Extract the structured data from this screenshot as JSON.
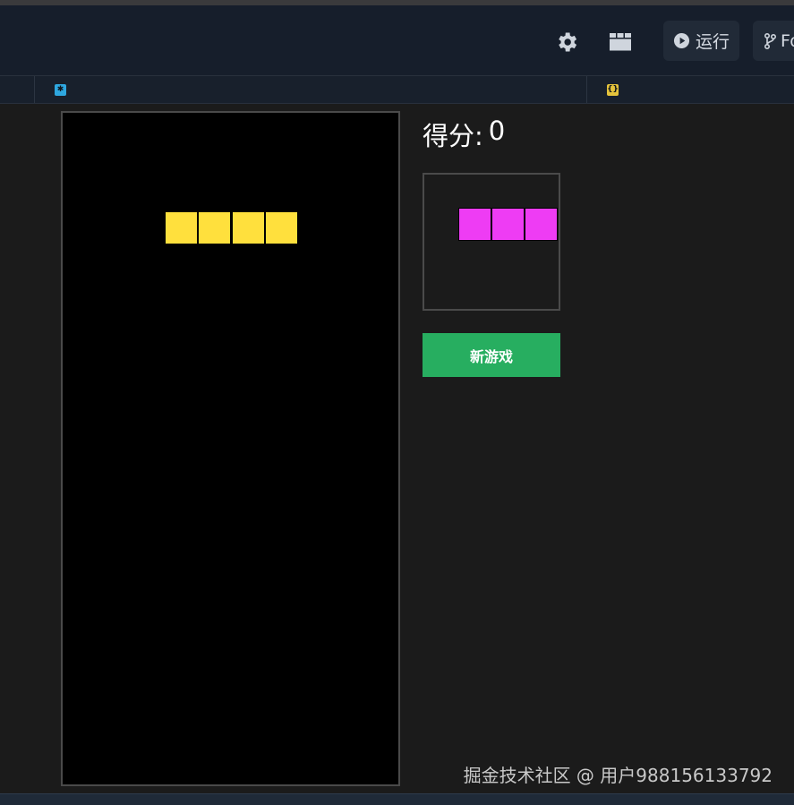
{
  "toolbar": {
    "icons": {
      "settings": "gear-icon",
      "layout": "layout-grid-icon",
      "run": "play-icon",
      "fork": "branch-icon"
    },
    "run_label": "运行",
    "fork_label": "Fo"
  },
  "tabs": [
    {
      "icon": "snowflake-icon",
      "icon_color": "#2ea7e0"
    },
    {
      "icon": "braces-icon",
      "icon_color": "#e5c33c"
    }
  ],
  "game": {
    "score_label": "得分:",
    "score_value": "0",
    "new_game_label": "新游戏",
    "active_piece": {
      "type": "I",
      "color": "#ffe03d",
      "cells": [
        [
          3,
          3
        ],
        [
          4,
          3
        ],
        [
          5,
          3
        ],
        [
          6,
          3
        ]
      ]
    },
    "next_piece": {
      "color": "#ee3cf4",
      "cells": [
        [
          1,
          1
        ],
        [
          2,
          1
        ],
        [
          3,
          1
        ]
      ]
    }
  },
  "watermark": "掘金技术社区 @ 用户988156133792",
  "colors": {
    "toolbar_bg": "#161e2b",
    "content_bg": "#1b1b1b",
    "board_bg": "#000000",
    "button_green": "#27ae60"
  }
}
